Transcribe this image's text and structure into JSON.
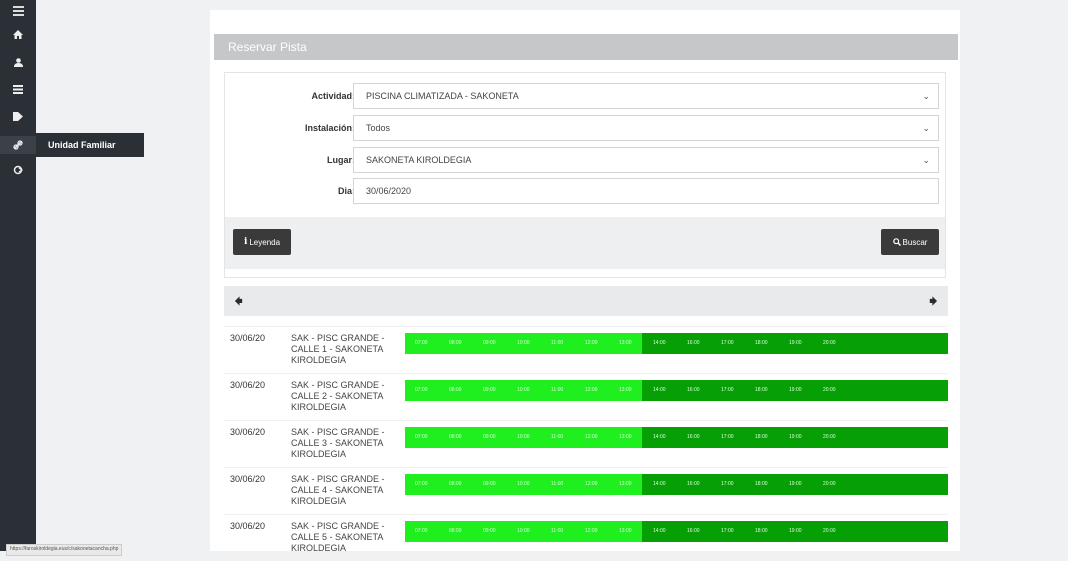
{
  "sidebar": {
    "icons": [
      "menu-icon",
      "home-icon",
      "user-icon",
      "list-icon",
      "tags-icon",
      "link-icon",
      "logout-icon"
    ],
    "tooltip": "Unidad Familiar"
  },
  "page": {
    "title": "Reservar Pista"
  },
  "form": {
    "actividad_label": "Actividad:",
    "actividad_value": "PISCINA CLIMATIZADA - SAKONETA",
    "instalacion_label": "Instalación:",
    "instalacion_value": "Todos",
    "lugar_label": "Lugar:",
    "lugar_value": "SAKONETA KIROLDEGIA",
    "dia_label": "Dia:",
    "dia_value": "30/06/2020"
  },
  "buttons": {
    "leyenda": "Leyenda",
    "buscar": "Buscar"
  },
  "slot_times": [
    "07:00",
    "08:00",
    "09:00",
    "10:00",
    "11:00",
    "12:00",
    "13:00",
    "14:00",
    "16:00",
    "17:00",
    "18:00",
    "19:00",
    "20:00"
  ],
  "rows": [
    {
      "date": "30/06/20",
      "court": "SAK - PISC GRANDE - CALLE 1 - SAKONETA KIROLDEGIA"
    },
    {
      "date": "30/06/20",
      "court": "SAK - PISC GRANDE - CALLE 2 - SAKONETA KIROLDEGIA"
    },
    {
      "date": "30/06/20",
      "court": "SAK - PISC GRANDE - CALLE 3 - SAKONETA KIROLDEGIA"
    },
    {
      "date": "30/06/20",
      "court": "SAK - PISC GRANDE - CALLE 4 - SAKONETA KIROLDEGIA"
    },
    {
      "date": "30/06/20",
      "court": "SAK - PISC GRANDE - CALLE 5 - SAKONETA KIROLDEGIA"
    }
  ],
  "colors": {
    "slot_light": "#1fef1f",
    "slot_dark": "#06a006",
    "sidebar": "#2b3036"
  },
  "status_url": "https://faroskiroldegia.eus/c/sakonetacancha.php"
}
